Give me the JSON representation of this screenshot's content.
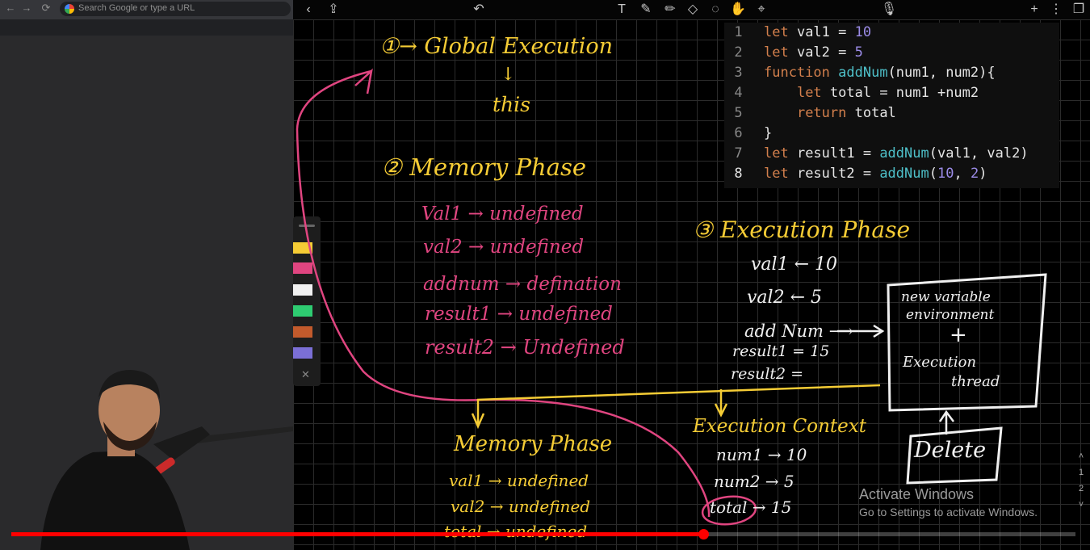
{
  "browser": {
    "omnibox_placeholder": "Search Google or type a URL",
    "nav": [
      "←",
      "→",
      "⟳"
    ]
  },
  "toolbar": {
    "left_icons": [
      "back-icon",
      "share-icon",
      "undo-icon"
    ],
    "tool_icons": [
      "text-tool-icon",
      "pen-tool-icon",
      "highlighter-tool-icon",
      "eraser-tool-icon",
      "lasso-tool-icon",
      "hand-tool-icon",
      "pointer-tool-icon",
      "microphone-icon"
    ],
    "right_icons": [
      "add-icon",
      "more-icon",
      "pages-icon"
    ]
  },
  "palette": {
    "pens": [
      "#f5cc35",
      "#e04580",
      "#f0f0f0",
      "#2ecc71",
      "#c25a2c",
      "#7b6fd6"
    ],
    "close": "✕"
  },
  "code": {
    "lines": [
      {
        "num": "1",
        "text": "let val1 = 10"
      },
      {
        "num": "2",
        "text": "let val2 = 5"
      },
      {
        "num": "3",
        "text": "function addNum(num1, num2){"
      },
      {
        "num": "4",
        "text": "    let total = num1 +num2"
      },
      {
        "num": "5",
        "text": "    return total"
      },
      {
        "num": "6",
        "text": "}"
      },
      {
        "num": "7",
        "text": "let result1 = addNum(val1, val2)"
      },
      {
        "num": "8",
        "text": "let result2 = addNum(10, 2)"
      }
    ],
    "highlighted_line": "8"
  },
  "notes": {
    "step1": "①→ Global Execution",
    "arrow_down": "↓",
    "this": "this",
    "step2": "② Memory Phase",
    "memory": [
      "Val1 → undefined",
      "val2 → undefined",
      "addnum → defination",
      "result1 → undefined",
      "result2 → Undefined"
    ],
    "step3": "③ Execution Phase",
    "execution": [
      "val1 ← 10",
      "val2 ← 5",
      "add Num ⟶",
      "result1 = 15",
      "result2 ="
    ],
    "box_lines": [
      "new variable",
      "environment",
      "+",
      "Execution",
      "thread"
    ],
    "delete": "Delete",
    "exec_context": "Execution Context",
    "exec_context_rows": [
      "num1 → 10",
      "num2 → 5",
      "total → 15"
    ],
    "memory_phase_2": "Memory Phase",
    "memory2": [
      "val1 → undefined",
      "val2 → undefined",
      "total → undefined"
    ]
  },
  "watermark": {
    "title": "Activate Windows",
    "subtitle": "Go to Settings to activate Windows."
  },
  "pages": [
    "1",
    "2"
  ],
  "video": {
    "progress": 0.65
  }
}
